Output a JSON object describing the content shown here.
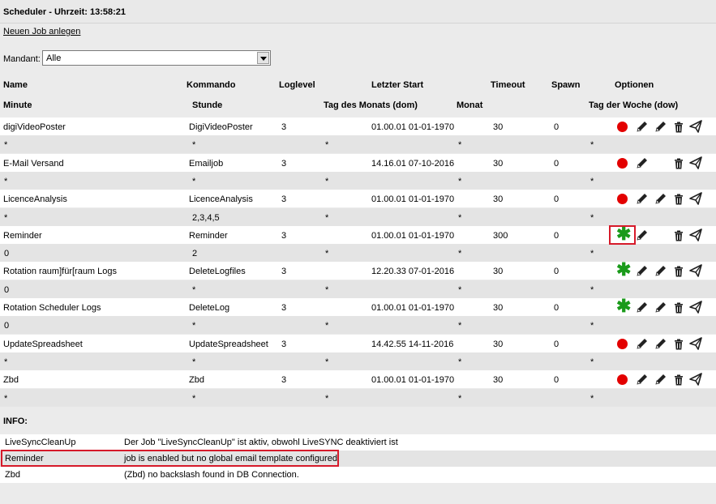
{
  "header": {
    "title": "Scheduler  -  Uhrzeit: 13:58:21"
  },
  "new_job_label": "Neuen Job anlegen",
  "mandant": {
    "label": "Mandant:",
    "value": "Alle"
  },
  "columns": {
    "row1": [
      "Name",
      "Kommando",
      "Loglevel",
      "Letzter Start",
      "Timeout",
      "Spawn",
      "Optionen"
    ],
    "row2": [
      "Minute",
      "Stunde",
      "Tag des Monats (dom)",
      "Monat",
      "Tag der Woche (dow)"
    ]
  },
  "jobs": [
    {
      "name": "digiVideoPoster",
      "command": "DigiVideoPoster",
      "loglevel": "3",
      "last_start": "01.00.01 01-01-1970",
      "timeout": "30",
      "spawn": "0",
      "status": "disabled",
      "minute": "*",
      "hour": "*",
      "dom": "*",
      "month": "*",
      "dow": "*",
      "edit_icons": 2
    },
    {
      "name": "E-Mail Versand",
      "command": "Emailjob",
      "loglevel": "3",
      "last_start": "14.16.01 07-10-2016",
      "timeout": "30",
      "spawn": "0",
      "status": "disabled",
      "minute": "*",
      "hour": "*",
      "dom": "*",
      "month": "*",
      "dow": "*",
      "edit_icons": 1
    },
    {
      "name": "LicenceAnalysis",
      "command": "LicenceAnalysis",
      "loglevel": "3",
      "last_start": "01.00.01 01-01-1970",
      "timeout": "30",
      "spawn": "0",
      "status": "disabled",
      "minute": "*",
      "hour": "2,3,4,5",
      "dom": "*",
      "month": "*",
      "dow": "*",
      "edit_icons": 2
    },
    {
      "name": "Reminder",
      "command": "Reminder",
      "loglevel": "3",
      "last_start": "01.00.01 01-01-1970",
      "timeout": "300",
      "spawn": "0",
      "status": "enabled",
      "minute": "0",
      "hour": "2",
      "dom": "*",
      "month": "*",
      "dow": "*",
      "edit_icons": 1
    },
    {
      "name": "Rotation raum]für[raum Logs",
      "command": "DeleteLogfiles",
      "loglevel": "3",
      "last_start": "12.20.33 07-01-2016",
      "timeout": "30",
      "spawn": "0",
      "status": "enabled",
      "minute": "0",
      "hour": "*",
      "dom": "*",
      "month": "*",
      "dow": "*",
      "edit_icons": 2
    },
    {
      "name": "Rotation Scheduler Logs",
      "command": "DeleteLog",
      "loglevel": "3",
      "last_start": "01.00.01 01-01-1970",
      "timeout": "30",
      "spawn": "0",
      "status": "enabled",
      "minute": "0",
      "hour": "*",
      "dom": "*",
      "month": "*",
      "dow": "*",
      "edit_icons": 2
    },
    {
      "name": "UpdateSpreadsheet",
      "command": "UpdateSpreadsheet",
      "loglevel": "3",
      "last_start": "14.42.55 14-11-2016",
      "timeout": "30",
      "spawn": "0",
      "status": "disabled",
      "minute": "*",
      "hour": "*",
      "dom": "*",
      "month": "*",
      "dow": "*",
      "edit_icons": 2
    },
    {
      "name": "Zbd",
      "command": "Zbd",
      "loglevel": "3",
      "last_start": "01.00.01 01-01-1970",
      "timeout": "30",
      "spawn": "0",
      "status": "disabled",
      "minute": "*",
      "hour": "*",
      "dom": "*",
      "month": "*",
      "dow": "*",
      "edit_icons": 2
    }
  ],
  "info": {
    "label": "INFO:",
    "rows": [
      {
        "job": "LiveSyncCleanUp",
        "message": "Der Job \"LiveSyncCleanUp\" ist aktiv, obwohl LiveSYNC deaktiviert ist"
      },
      {
        "job": "Reminder",
        "message": "job is enabled but no global email template configured!"
      },
      {
        "job": "Zbd",
        "message": "(Zbd) no backslash found in DB Connection."
      }
    ]
  },
  "colors": {
    "enabled": "#1a9a1a",
    "disabled": "#e30000",
    "highlight": "#d61a2a",
    "row_alt": "#e4e4e4"
  },
  "icons": [
    "status-dot-icon",
    "asterisk-icon",
    "pencil-icon",
    "trash-icon",
    "paper-plane-icon",
    "chevron-down-icon"
  ]
}
